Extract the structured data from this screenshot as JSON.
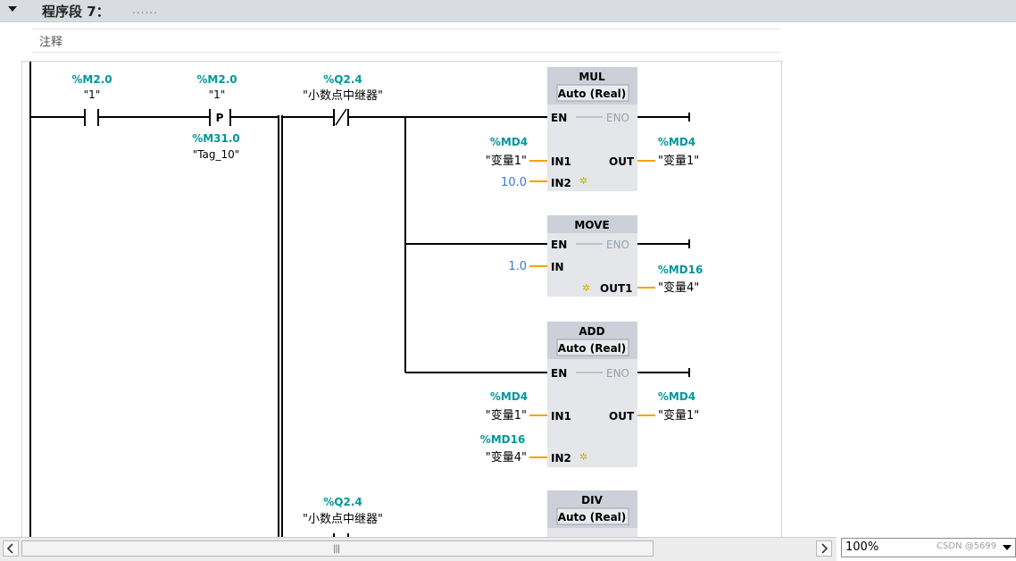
{
  "network": {
    "title": "程序段 7：",
    "dots": "......",
    "comment": "注释"
  },
  "contacts": {
    "c1": {
      "address": "%M2.0",
      "name": "\"1\""
    },
    "c2": {
      "address": "%M2.0",
      "name": "\"1\"",
      "symbol": "P",
      "edge_address": "%M31.0",
      "edge_name": "\"Tag_10\""
    },
    "c3": {
      "address": "%Q2.4",
      "name": "\"小数点中继器\""
    },
    "c4": {
      "address": "%Q2.4",
      "name": "\"小数点中继器\""
    }
  },
  "boxes": {
    "mul": {
      "title": "MUL",
      "subtitle": "Auto (Real)",
      "en": "EN",
      "eno": "ENO",
      "in1": "IN1",
      "in2": "IN2",
      "out": "OUT",
      "in1_addr": "%MD4",
      "in1_name": "\"变量1\"",
      "in2_value": "10.0",
      "out_addr": "%MD4",
      "out_name": "\"变量1\""
    },
    "move": {
      "title": "MOVE",
      "en": "EN",
      "eno": "ENO",
      "in": "IN",
      "out1": "OUT1",
      "in_value": "1.0",
      "out_addr": "%MD16",
      "out_name": "\"变量4\""
    },
    "add": {
      "title": "ADD",
      "subtitle": "Auto (Real)",
      "en": "EN",
      "eno": "ENO",
      "in1": "IN1",
      "in2": "IN2",
      "out": "OUT",
      "in1_addr": "%MD4",
      "in1_name": "\"变量1\"",
      "in2_addr": "%MD16",
      "in2_name": "\"变量4\"",
      "out_addr": "%MD4",
      "out_name": "\"变量1\""
    },
    "div": {
      "title": "DIV",
      "subtitle": "Auto (Real)"
    }
  },
  "zoom": "100%",
  "watermark": "CSDN @5699",
  "colors": {
    "address": "#00979c",
    "literal": "#3a7bd5",
    "box_bg": "#e4e6ea",
    "box_title_bg": "#cdd0d8",
    "wire": "#000000",
    "param_wire": "#f2a400"
  }
}
